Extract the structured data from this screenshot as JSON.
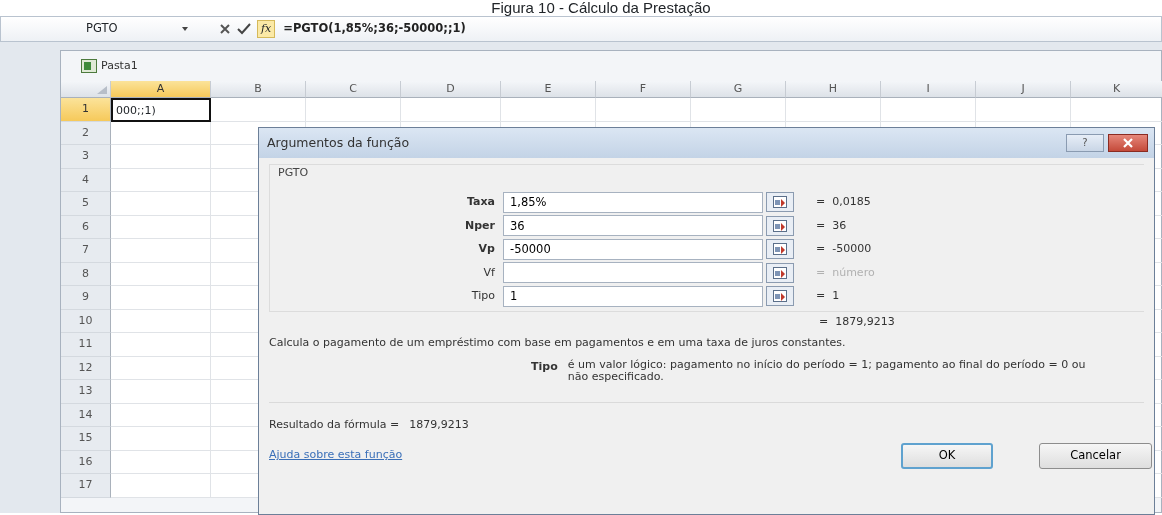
{
  "caption": "Figura 10 - Cálculo da Prestação",
  "formula_bar": {
    "name_box": "PGTO",
    "function_button": "fx",
    "formula": "=PGTO(1,85%;36;-50000;;1)"
  },
  "workbook": {
    "title": "Pasta1",
    "columns": [
      {
        "label": "A",
        "selected": true
      },
      {
        "label": "B",
        "selected": false
      },
      {
        "label": "C",
        "selected": false
      },
      {
        "label": "D",
        "selected": false
      },
      {
        "label": "E",
        "selected": false
      },
      {
        "label": "F",
        "selected": false
      },
      {
        "label": "G",
        "selected": false
      },
      {
        "label": "H",
        "selected": false
      },
      {
        "label": "I",
        "selected": false
      },
      {
        "label": "J",
        "selected": false
      },
      {
        "label": "K",
        "selected": false
      }
    ],
    "rows": [
      {
        "label": "1",
        "selected": true,
        "cell_a": "000;;1)"
      },
      {
        "label": "2",
        "selected": false
      },
      {
        "label": "3",
        "selected": false
      },
      {
        "label": "4",
        "selected": false
      },
      {
        "label": "5",
        "selected": false
      },
      {
        "label": "6",
        "selected": false
      },
      {
        "label": "7",
        "selected": false
      },
      {
        "label": "8",
        "selected": false
      },
      {
        "label": "9",
        "selected": false
      },
      {
        "label": "10",
        "selected": false
      },
      {
        "label": "11",
        "selected": false
      },
      {
        "label": "12",
        "selected": false
      },
      {
        "label": "13",
        "selected": false
      },
      {
        "label": "14",
        "selected": false
      },
      {
        "label": "15",
        "selected": false
      },
      {
        "label": "16",
        "selected": false
      },
      {
        "label": "17",
        "selected": false
      }
    ]
  },
  "dialog": {
    "title": "Argumentos da função",
    "help_button": "?",
    "function": "PGTO",
    "arguments": [
      {
        "label": "Taxa",
        "required": true,
        "value": "1,85%",
        "result": "0,0185",
        "result_muted": false
      },
      {
        "label": "Nper",
        "required": true,
        "value": "36",
        "result": "36",
        "result_muted": false
      },
      {
        "label": "Vp",
        "required": true,
        "value": "-50000",
        "result": "-50000",
        "result_muted": false
      },
      {
        "label": "Vf",
        "required": false,
        "result": "número",
        "result_muted": true
      },
      {
        "label": "Tipo",
        "required": false,
        "value": "1",
        "result": "1",
        "result_muted": false
      }
    ],
    "equals": "=",
    "formula_result": "1879,9213",
    "description": "Calcula o pagamento de um empréstimo com base em pagamentos e em uma taxa de juros constantes.",
    "argument_help": {
      "name": "Tipo",
      "text": "é um valor lógico: pagamento no início do período = 1; pagamento ao final do período = 0 ou não especificado."
    },
    "result_label": "Resultado da fórmula =",
    "result_value": "1879,9213",
    "help_link": "Ajuda sobre esta função",
    "buttons": [
      {
        "label": "OK",
        "default": true
      },
      {
        "label": "Cancelar",
        "default": false
      }
    ]
  }
}
